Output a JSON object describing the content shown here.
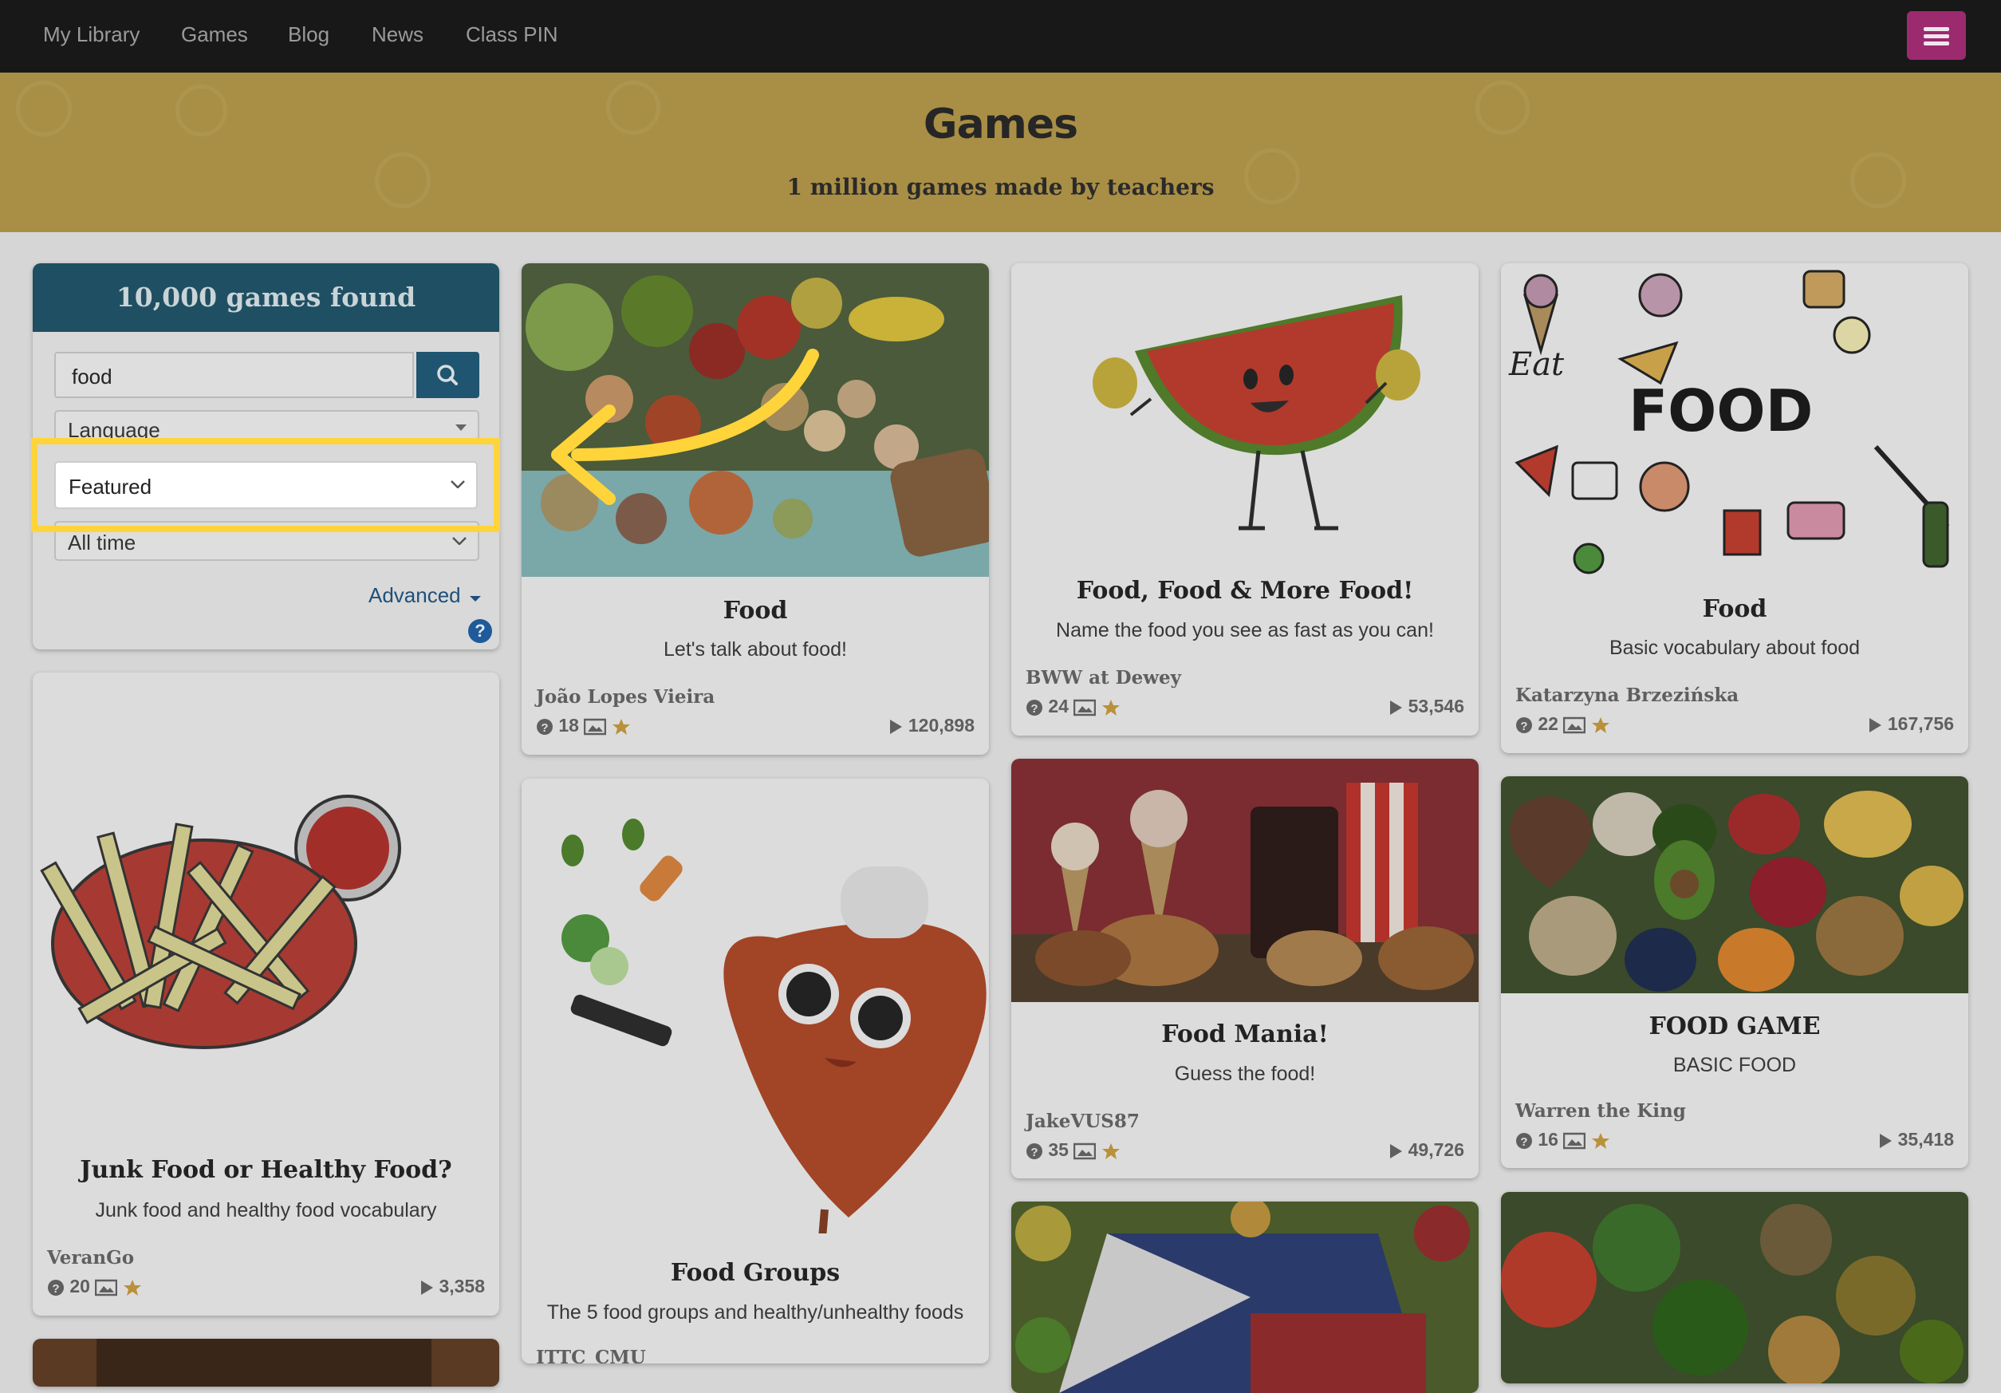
{
  "nav": {
    "items": [
      "My Library",
      "Games",
      "Blog",
      "News",
      "Class PIN"
    ]
  },
  "banner": {
    "title": "Games",
    "subtitle": "1 million games made by teachers"
  },
  "sidebar": {
    "header": "10,000 games found",
    "search_value": "food",
    "language_placeholder": "Language",
    "sort_value": "Featured",
    "time_value": "All time",
    "advanced_label": "Advanced",
    "help": "?"
  },
  "cards": [
    {
      "title": "Food",
      "desc": "Let's talk about food!",
      "author": "João Lopes Vieira",
      "questions": "18",
      "plays": "120,898"
    },
    {
      "title": "Food, Food & More Food!",
      "desc": "Name the food you see as fast as you can!",
      "author": "BWW at Dewey",
      "questions": "24",
      "plays": "53,546"
    },
    {
      "title": "Food",
      "desc": "Basic vocabulary about food",
      "author": "Katarzyna Brzezińska",
      "questions": "22",
      "plays": "167,756"
    },
    {
      "title": "Junk Food or Healthy Food?",
      "desc": "Junk food and healthy food vocabulary",
      "author": "VeranGo",
      "questions": "20",
      "plays": "3,358"
    },
    {
      "title": "Food Groups",
      "desc": "The 5 food groups and healthy/unhealthy foods",
      "author": "ITTC_CMU"
    },
    {
      "title": "Food Mania!",
      "desc": "Guess the food!",
      "author": "JakeVUS87",
      "questions": "35",
      "plays": "49,726"
    },
    {
      "title": "FOOD GAME",
      "desc": "BASIC FOOD",
      "author": "Warren the King",
      "questions": "16",
      "plays": "35,418"
    }
  ],
  "image_text": {
    "food_doodle": "FOOD"
  },
  "colors": {
    "nav": "#181818",
    "banner": "#a98f45",
    "sidebar_header": "#1f4f62",
    "highlight": "#ffd43a",
    "menu_button": "#9c2a6f"
  }
}
